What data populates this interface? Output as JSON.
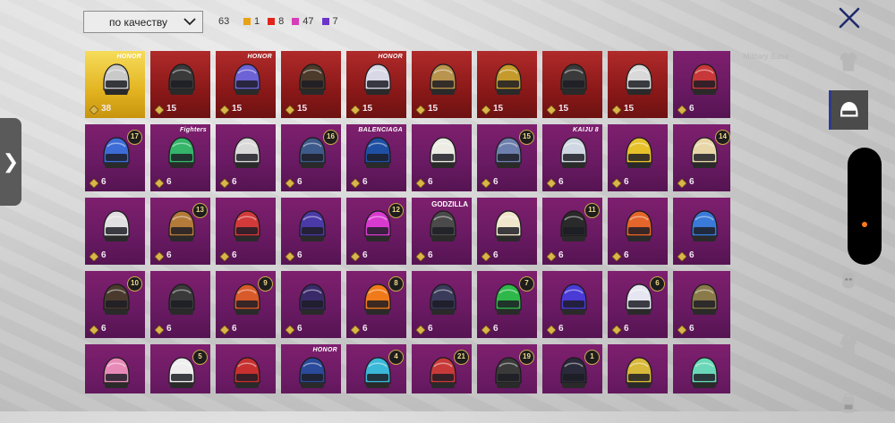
{
  "sort": {
    "label": "по качеству"
  },
  "counts": {
    "total": "63",
    "tiers": [
      {
        "value": "1",
        "color": "#e8a214"
      },
      {
        "value": "8",
        "color": "#e0241c"
      },
      {
        "value": "47",
        "color": "#d63bb8"
      },
      {
        "value": "7",
        "color": "#6b34c9"
      }
    ]
  },
  "watermark": "Military Base",
  "colors": {
    "legendary": "#e2b320",
    "mythic": "#8a1818",
    "epic": "#6a1a63",
    "accent": "#2d3a8c"
  },
  "items": [
    {
      "tier": "legendary",
      "qty": "38",
      "brand": "HONOR",
      "hue": "#c9c9c9"
    },
    {
      "tier": "mythic",
      "qty": "15",
      "hue": "#3a3a3a"
    },
    {
      "tier": "mythic",
      "qty": "15",
      "brand": "HONOR",
      "hue": "#6d63d6"
    },
    {
      "tier": "mythic",
      "qty": "15",
      "hue": "#4c3a2a"
    },
    {
      "tier": "mythic",
      "qty": "15",
      "brand": "HONOR",
      "hue": "#d8d8e6"
    },
    {
      "tier": "mythic",
      "qty": "15",
      "hue": "#b8944e"
    },
    {
      "tier": "mythic",
      "qty": "15",
      "hue": "#c49a2c"
    },
    {
      "tier": "mythic",
      "qty": "15",
      "hue": "#3a3a3a"
    },
    {
      "tier": "mythic",
      "qty": "15",
      "hue": "#d9d9d9"
    },
    {
      "tier": "epic",
      "qty": "6",
      "hue": "#c8383a"
    },
    {
      "tier": "epic",
      "qty": "6",
      "lvl": "17",
      "hue": "#3d6cd6"
    },
    {
      "tier": "epic",
      "qty": "6",
      "brand": "Fighters",
      "hue": "#35b56a"
    },
    {
      "tier": "epic",
      "qty": "6",
      "hue": "#d9d9d9"
    },
    {
      "tier": "epic",
      "qty": "6",
      "lvl": "16",
      "hue": "#3e5a8a"
    },
    {
      "tier": "epic",
      "qty": "6",
      "brand": "BALENCIAGA",
      "hue": "#1f4fa3"
    },
    {
      "tier": "epic",
      "qty": "6",
      "hue": "#ecece4"
    },
    {
      "tier": "epic",
      "qty": "6",
      "lvl": "15",
      "hue": "#6d7fae"
    },
    {
      "tier": "epic",
      "qty": "6",
      "brand": "KAIJU 8",
      "hue": "#cfd8e2"
    },
    {
      "tier": "epic",
      "qty": "6",
      "hue": "#e7c12a"
    },
    {
      "tier": "epic",
      "qty": "6",
      "lvl": "14",
      "hue": "#e8d6a8"
    },
    {
      "tier": "epic",
      "qty": "6",
      "hue": "#e0e0e0"
    },
    {
      "tier": "epic",
      "qty": "6",
      "lvl": "13",
      "hue": "#b37a3a"
    },
    {
      "tier": "epic",
      "qty": "6",
      "hue": "#d23a3a"
    },
    {
      "tier": "epic",
      "qty": "6",
      "hue": "#4a3aa8"
    },
    {
      "tier": "epic",
      "qty": "6",
      "lvl": "12",
      "hue": "#d83ad0"
    },
    {
      "tier": "epic",
      "qty": "6",
      "brand": "GODZILLA",
      "hue": "#4a4a4a"
    },
    {
      "tier": "epic",
      "qty": "6",
      "hue": "#f0e6cc"
    },
    {
      "tier": "epic",
      "qty": "6",
      "lvl": "11",
      "hue": "#2a2a2a"
    },
    {
      "tier": "epic",
      "qty": "6",
      "hue": "#e5662a"
    },
    {
      "tier": "epic",
      "qty": "6",
      "hue": "#3a7ad8"
    },
    {
      "tier": "epic",
      "qty": "6",
      "lvl": "10",
      "hue": "#4a3a2e"
    },
    {
      "tier": "epic",
      "qty": "6",
      "hue": "#3a3a3a"
    },
    {
      "tier": "epic",
      "qty": "6",
      "lvl": "9",
      "hue": "#d85a2a"
    },
    {
      "tier": "epic",
      "qty": "6",
      "hue": "#3a2a6a"
    },
    {
      "tier": "epic",
      "qty": "6",
      "lvl": "8",
      "hue": "#f07a1a"
    },
    {
      "tier": "epic",
      "qty": "6",
      "hue": "#3a3a5a"
    },
    {
      "tier": "epic",
      "qty": "6",
      "lvl": "7",
      "hue": "#2fb84a"
    },
    {
      "tier": "epic",
      "qty": "6",
      "hue": "#4a3ad6"
    },
    {
      "tier": "epic",
      "qty": "6",
      "lvl": "6",
      "hue": "#e6e6f2"
    },
    {
      "tier": "epic",
      "qty": "6",
      "hue": "#8a7a4a"
    },
    {
      "tier": "epic",
      "qty": "",
      "hue": "#e88ab8"
    },
    {
      "tier": "epic",
      "qty": "",
      "lvl": "5",
      "hue": "#eeeeee"
    },
    {
      "tier": "epic",
      "qty": "",
      "hue": "#c83030"
    },
    {
      "tier": "epic",
      "qty": "",
      "brand": "HONOR",
      "hue": "#2a4a9a"
    },
    {
      "tier": "epic",
      "qty": "",
      "lvl": "4",
      "hue": "#3ab8d8"
    },
    {
      "tier": "epic",
      "qty": "",
      "lvl": "21",
      "hue": "#c83a3a"
    },
    {
      "tier": "epic",
      "qty": "",
      "lvl": "19",
      "hue": "#3a3a3a"
    },
    {
      "tier": "epic",
      "qty": "",
      "lvl": "1",
      "hue": "#2a2a3a"
    },
    {
      "tier": "epic",
      "qty": "",
      "hue": "#d8b83a"
    },
    {
      "tier": "epic",
      "qty": "",
      "hue": "#6ad8b8"
    }
  ],
  "side_tabs": [
    {
      "icon": "outfit-icon"
    },
    {
      "icon": "helmet-icon",
      "active": true
    },
    {
      "icon": "mask-icon"
    },
    {
      "icon": "jacket-icon"
    },
    {
      "icon": "backpack-icon"
    }
  ]
}
